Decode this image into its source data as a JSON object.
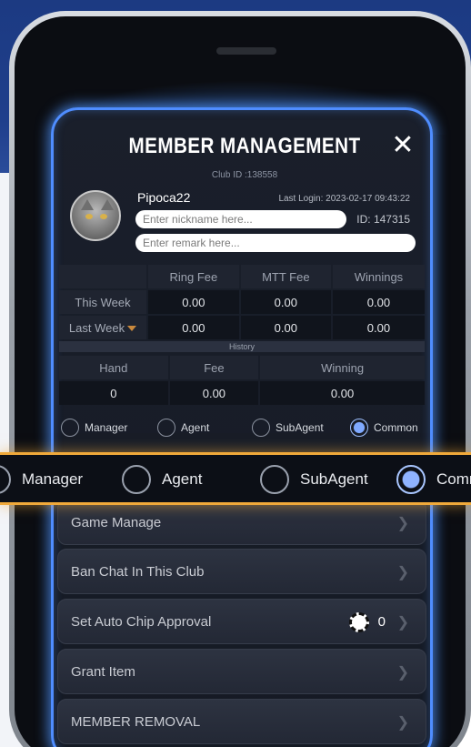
{
  "modal": {
    "title": "MEMBER MANAGEMENT",
    "close_icon": "close-icon",
    "club_id": "Club ID :138558"
  },
  "member": {
    "username": "Pipoca22",
    "last_login": "Last Login: 2023-02-17 09:43:22",
    "id": "ID: 147315",
    "nickname_placeholder": "Enter nickname here...",
    "remark_placeholder": "Enter remark here..."
  },
  "stats": {
    "headers": [
      "Ring Fee",
      "MTT Fee",
      "Winnings"
    ],
    "rows": [
      {
        "label": "This Week",
        "values": [
          "0.00",
          "0.00",
          "0.00"
        ]
      },
      {
        "label": "Last Week",
        "values": [
          "0.00",
          "0.00",
          "0.00"
        ]
      }
    ]
  },
  "history": {
    "title": "History",
    "headers": [
      "Hand",
      "Fee",
      "Winning"
    ],
    "values": [
      "0",
      "0.00",
      "0.00"
    ]
  },
  "roles": {
    "options": [
      "Manager",
      "Agent",
      "SubAgent",
      "Common"
    ],
    "zoom_last_label": "Comm",
    "selected": "Common"
  },
  "menu": {
    "game_manage": "Game Manage",
    "ban_chat": "Ban Chat In This Club",
    "auto_chip": "Set Auto Chip Approval",
    "auto_chip_count": "0",
    "grant_item": "Grant Item",
    "member_removal": "MEMBER REMOVAL"
  }
}
